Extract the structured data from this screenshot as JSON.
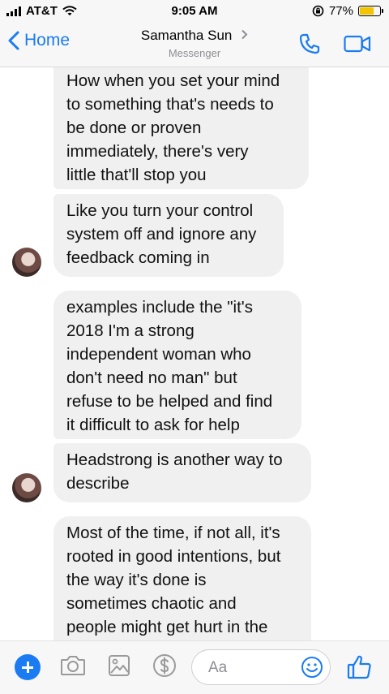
{
  "status_bar": {
    "carrier": "AT&T",
    "time": "9:05 AM",
    "battery": "77%",
    "battery_level": 0.77
  },
  "header": {
    "back_label": "Home",
    "contact_name": "Samantha Sun",
    "subtitle": "Messenger"
  },
  "messages": [
    {
      "text": "How when you set your mind\nto something that's needs to\nbe done or proven\nimmediately, there's very\nlittle that'll stop you"
    },
    {
      "text": "Like you turn your control\nsystem off and ignore any\nfeedback coming in"
    },
    {
      "text": "examples include the \"it's\n2018 I'm a strong\nindependent woman who\ndon't need no man\" but\nrefuse to be helped and find\nit difficult to ask for help"
    },
    {
      "text": "Headstrong is another way to\ndescribe"
    },
    {
      "text": "Most of the time, if not all, it's\nrooted in good intentions, but\nthe way it's done is\nsometimes chaotic and\npeople might get hurt in the"
    }
  ],
  "composer": {
    "placeholder": "Aa"
  },
  "colors": {
    "accent": "#1a7bf2",
    "bubble": "#f1f0f0",
    "bar": "#f7f7f7"
  }
}
